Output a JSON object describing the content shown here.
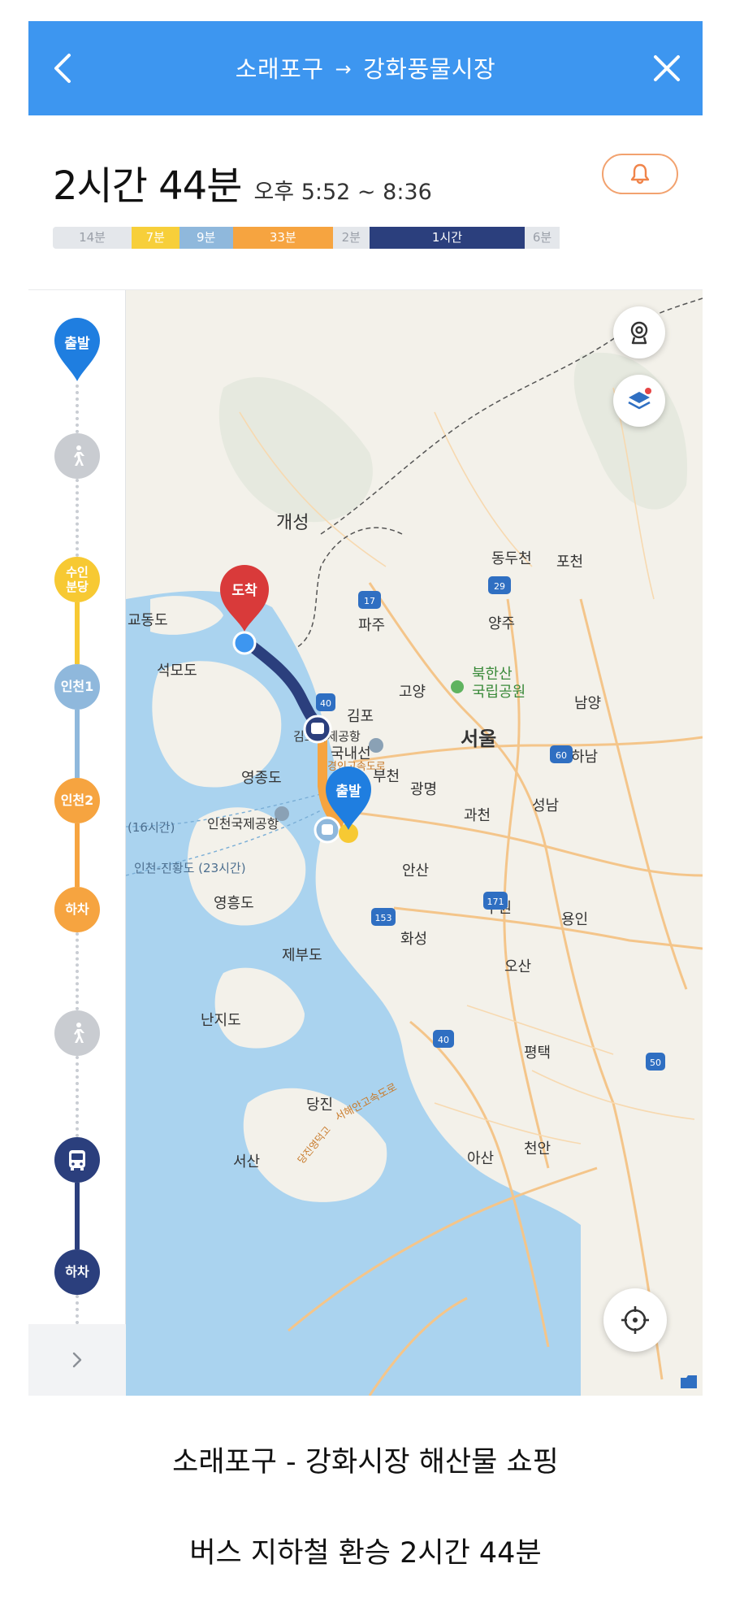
{
  "header": {
    "origin": "소래포구",
    "arrow": "→",
    "destination": "강화풍물시장"
  },
  "summary": {
    "duration": "2시간 44분",
    "time_range": "오후 5:52 ~ 8:36"
  },
  "segments": [
    {
      "label": "14분",
      "color": "#e4e7eb",
      "light": true,
      "pct": 12.6
    },
    {
      "label": "7분",
      "color": "#f7cf3a",
      "light": false,
      "pct": 7.6
    },
    {
      "label": "9분",
      "color": "#8fb8dc",
      "light": false,
      "pct": 8.6
    },
    {
      "label": "33분",
      "color": "#f6a440",
      "light": false,
      "pct": 16.0
    },
    {
      "label": "2분",
      "color": "#e4e7eb",
      "light": true,
      "pct": 5.8
    },
    {
      "label": "1시간",
      "color": "#2b3f7d",
      "light": false,
      "pct": 24.9
    },
    {
      "label": "6분",
      "color": "#e4e7eb",
      "light": true,
      "pct": 5.5
    }
  ],
  "timeline": {
    "start": "출발",
    "stop_suin": "수인 분당",
    "stop_incheon1": "인천1",
    "stop_incheon2": "인천2",
    "alight1": "하차",
    "alight2": "하차"
  },
  "map": {
    "pin_arrive": "도착",
    "pin_depart": "출발",
    "places": {
      "gaeseong": "개성",
      "dongducheon": "동두천",
      "pocheon": "포천",
      "gyodongdo": "교동도",
      "paju": "파주",
      "yangju": "양주",
      "seongmodo": "석모도",
      "bukhansan": "북한산",
      "national_park": "국립공원",
      "goyang": "고양",
      "namyang": "남양",
      "gimpo": "김포",
      "gimpo_airport": "김포국제공항",
      "domestic": "국내선",
      "seoul": "서울",
      "hanam": "하남",
      "gyeongin_exp": "경인고속도로",
      "yeongjongdo": "영종도",
      "bucheon": "부천",
      "gwangmyeong": "광명",
      "gwacheon": "과천",
      "seongnam": "성남",
      "incheon_airport": "인천국제공항",
      "ferry1": "(16시간)",
      "ferry2": "인천-진황도 (23시간)",
      "ansan": "안산",
      "yeongheungdo": "영흥도",
      "suwon": "수원",
      "yongin": "용인",
      "hwaseong": "화성",
      "jebudo": "제부도",
      "osan": "오산",
      "nanjido": "난지도",
      "pyeongtaek": "평택",
      "dangjin": "당진",
      "seohaean_exp": "서해안고속도로",
      "dangjin_yeongdeok": "당진영덕고",
      "asan": "아산",
      "cheonan": "천안",
      "seosan": "서산",
      "route_17": "17",
      "route_29": "29",
      "route_40a": "40",
      "route_60": "60",
      "route_171": "171",
      "route_153": "153",
      "route_40b": "40",
      "route_50": "50"
    }
  },
  "captions": {
    "line1": "소래포구 - 강화시장 해산물 쇼핑",
    "line2": "버스 지하철 환승 2시간 44분"
  }
}
